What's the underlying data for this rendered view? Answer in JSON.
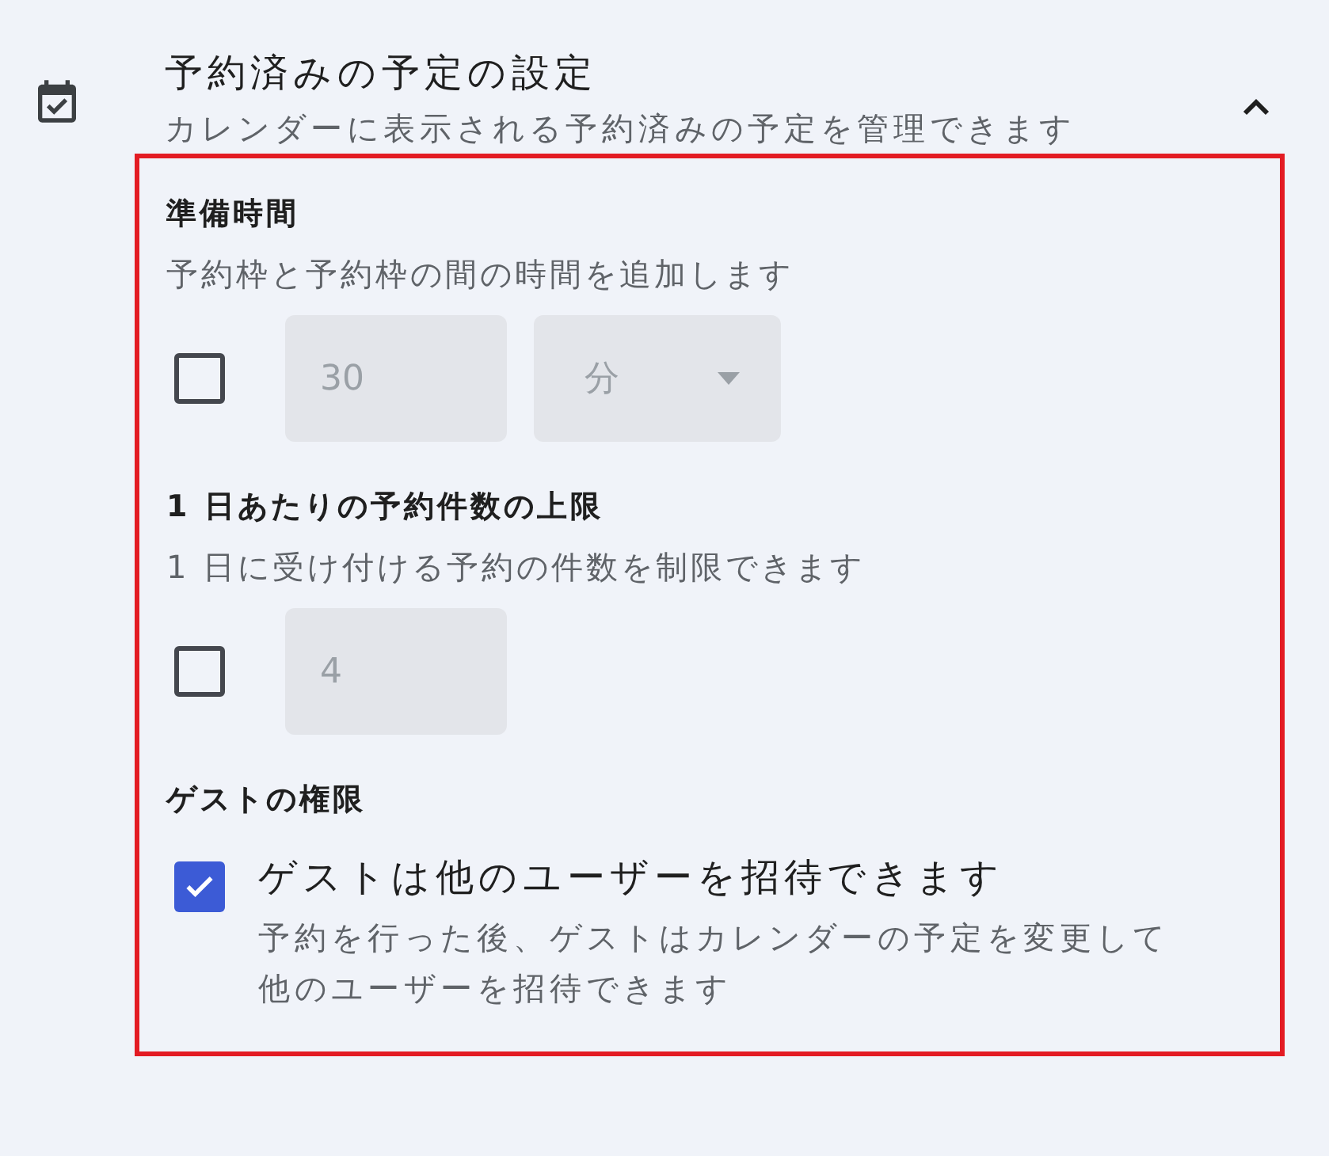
{
  "section": {
    "title": "予約済みの予定の設定",
    "subtitle": "カレンダーに表示される予約済みの予定を管理できます",
    "expanded": true
  },
  "groups": [
    {
      "kind": "inputs",
      "title": "準備時間",
      "description": "予約枠と予約枠の間の時間を追加します",
      "checked": false,
      "value": "30",
      "unit": "分"
    },
    {
      "kind": "inputs",
      "title": "1 日あたりの予約件数の上限",
      "description": "1 日に受け付ける予約の件数を制限できます",
      "checked": false,
      "value": "4"
    },
    {
      "kind": "option",
      "title": "ゲストの権限",
      "checked": true,
      "label": "ゲストは他のユーザーを招待できます",
      "description": "予約を行った後、ゲストはカレンダーの予定を変更して他のユーザーを招待できます"
    }
  ]
}
